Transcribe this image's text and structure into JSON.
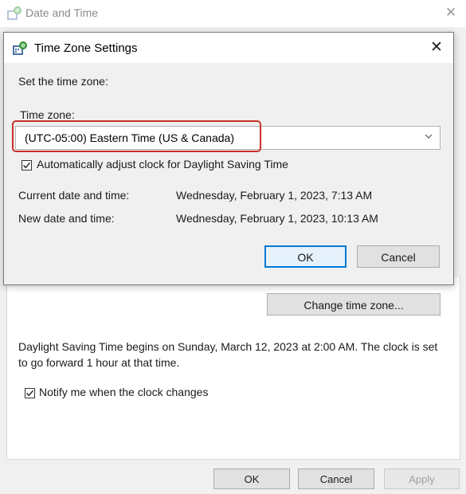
{
  "outer_window": {
    "title": "Date and Time",
    "close_glyph": "✕",
    "change_tz_button": "Change time zone...",
    "dst_info": "Daylight Saving Time begins on Sunday, March 12, 2023 at 2:00 AM. The clock is set to go forward 1 hour at that time.",
    "notify_label": "Notify me when the clock changes",
    "notify_checked": true,
    "ok_label": "OK",
    "cancel_label": "Cancel",
    "apply_label": "Apply",
    "icon": "date-time-icon"
  },
  "dialog": {
    "title": "Time Zone Settings",
    "close_glyph": "✕",
    "set_tz_label": "Set the time zone:",
    "tz_label": "Time zone:",
    "tz_value": "(UTC-05:00) Eastern Time (US & Canada)",
    "auto_dst_label": "Automatically adjust clock for Daylight Saving Time",
    "auto_dst_checked": true,
    "current_label": "Current date and time:",
    "current_value": "Wednesday, February 1, 2023, 7:13 AM",
    "new_label": "New date and time:",
    "new_value": "Wednesday, February 1, 2023, 10:13 AM",
    "ok_label": "OK",
    "cancel_label": "Cancel",
    "icon": "date-time-icon"
  },
  "colors": {
    "highlight": "#c8312b",
    "focus_accent": "#0078d7",
    "dialog_bg": "#f0f0f0"
  }
}
